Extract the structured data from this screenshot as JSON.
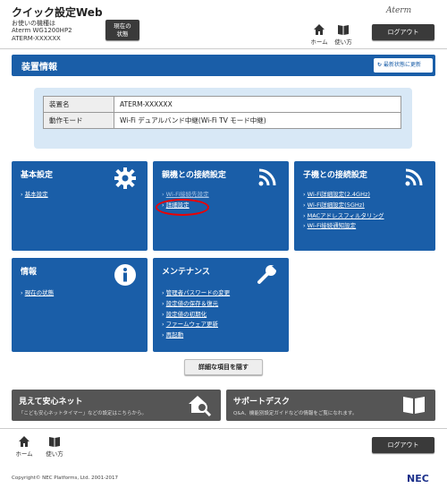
{
  "header": {
    "app_title": "クイック設定Web",
    "model_label": "お使いの機種は",
    "model_name": "Aterm WG1200HP2",
    "device_name": "ATERM-XXXXXX",
    "status_button_line1": "現在の",
    "status_button_line2": "状態",
    "brand": "Aterm",
    "home_label": "ホーム",
    "help_label": "使い方",
    "logout_label": "ログアウト"
  },
  "section": {
    "title": "装置情報",
    "refresh_label": "最新状態に更新"
  },
  "device_info": [
    {
      "key": "装置名",
      "value": "ATERM-XXXXXX"
    },
    {
      "key": "動作モード",
      "value": "Wi-Fi デュアルバンド中継(Wi-Fi TV モード中継)"
    }
  ],
  "cards": {
    "basic": {
      "title": "基本設定",
      "icon": "gear-icon",
      "links": [
        "基本設定"
      ]
    },
    "parent": {
      "title": "親機との接続設定",
      "icon": "wifi-icon",
      "links": [
        "Wi-Fi接続先設定",
        "詳細設定"
      ]
    },
    "child": {
      "title": "子機との接続設定",
      "icon": "wifi-icon",
      "links": [
        "Wi-Fi詳細設定(2.4GHz)",
        "Wi-Fi詳細設定(5GHz)",
        "MACアドレスフィルタリング",
        "Wi-Fi接続通知設定"
      ]
    },
    "info": {
      "title": "情報",
      "icon": "info-icon",
      "links": [
        "現在の状態"
      ]
    },
    "maint": {
      "title": "メンテナンス",
      "icon": "wrench-icon",
      "links": [
        "管理者パスワードの変更",
        "設定値の保存＆復元",
        "設定値の初期化",
        "ファームウェア更新",
        "再起動"
      ]
    }
  },
  "hide_button": "詳細な項目を隠す",
  "banners": {
    "safe_net": {
      "title": "見えて安心ネット",
      "desc": "「こども安心ネットタイマー」などの設定はこちらから。",
      "icon": "house-search-icon"
    },
    "support": {
      "title": "サポートデスク",
      "desc": "Q&A、機能別設定ガイドなどの情報をご覧になれます。",
      "icon": "book-icon"
    }
  },
  "footer": {
    "copyright": "Copyright© NEC Platforms, Ltd. 2001-2017",
    "logo": "NEC"
  },
  "colors": {
    "primary": "#1a5ea8",
    "dark": "#3a3a3a",
    "banner": "#555555",
    "highlight": "#ee0000"
  }
}
